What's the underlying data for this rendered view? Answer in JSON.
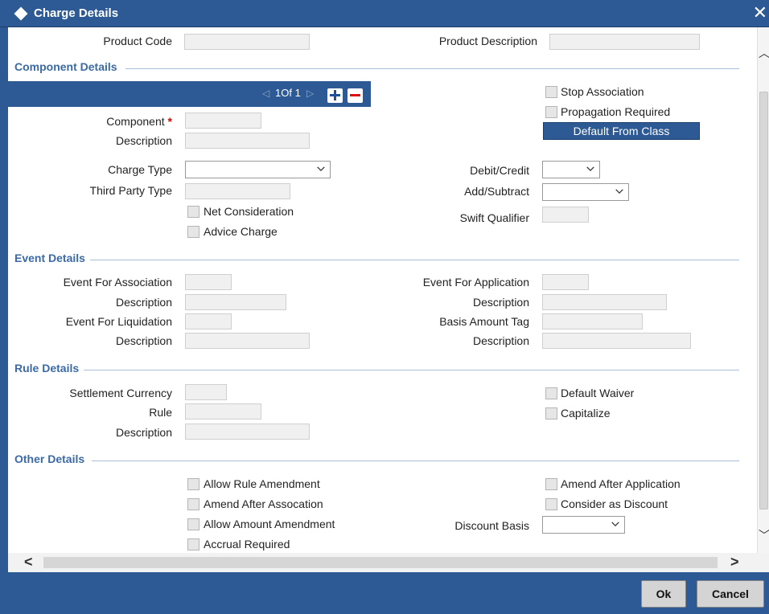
{
  "window": {
    "title": "Charge Details",
    "close_glyph": "✕"
  },
  "header": {
    "product_code_label": "Product Code",
    "product_code_value": "",
    "product_description_label": "Product Description",
    "product_description_value": ""
  },
  "sections": {
    "component": "Component Details",
    "event": "Event Details",
    "rule": "Rule Details",
    "other": "Other Details"
  },
  "component": {
    "pager_text": "1Of 1",
    "component_label": "Component",
    "required_mark": "*",
    "description_label": "Description",
    "charge_type_label": "Charge Type",
    "third_party_type_label": "Third Party Type",
    "net_consideration_label": "Net Consideration",
    "advice_charge_label": "Advice Charge",
    "stop_association_label": "Stop Association",
    "propagation_required_label": "Propagation Required",
    "default_from_class_label": "Default From Class",
    "debit_credit_label": "Debit/Credit",
    "add_subtract_label": "Add/Subtract",
    "swift_qualifier_label": "Swift Qualifier"
  },
  "event": {
    "event_for_association_label": "Event For Association",
    "description_label": "Description",
    "event_for_liquidation_label": "Event For Liquidation",
    "event_for_application_label": "Event For Application",
    "basis_amount_tag_label": "Basis Amount Tag"
  },
  "rule": {
    "settlement_currency_label": "Settlement Currency",
    "rule_label": "Rule",
    "description_label": "Description",
    "default_waiver_label": "Default Waiver",
    "capitalize_label": "Capitalize"
  },
  "other": {
    "allow_rule_amendment_label": "Allow Rule Amendment",
    "amend_after_assocation_label": "Amend After Assocation",
    "allow_amount_amendment_label": "Allow Amount Amendment",
    "accrual_required_label": "Accrual Required",
    "amend_after_application_label": "Amend After Application",
    "consider_as_discount_label": "Consider as Discount",
    "discount_basis_label": "Discount Basis"
  },
  "footer": {
    "ok_label": "Ok",
    "cancel_label": "Cancel"
  },
  "colors": {
    "brand": "#2d5a94",
    "section_title": "#3b6aa6",
    "required": "#d00"
  }
}
